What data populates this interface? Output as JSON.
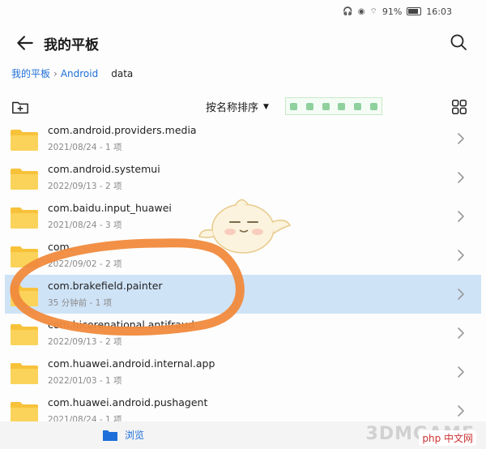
{
  "status_bar": {
    "battery": "91%",
    "time": "16:03"
  },
  "header": {
    "title": "我的平板"
  },
  "breadcrumb": {
    "items": [
      "我的平板",
      "Android"
    ],
    "current": "data"
  },
  "toolbar": {
    "sort_label": "按名称排序"
  },
  "files": [
    {
      "name": "com.android.providers.media",
      "meta": "2021/08/24 - 1 项"
    },
    {
      "name": "com.android.systemui",
      "meta": "2022/09/13 - 2 项"
    },
    {
      "name": "com.baidu.input_huawei",
      "meta": "2021/08/24 - 3 项"
    },
    {
      "name": "com.",
      "meta": "2022/09/02 - 2 项"
    },
    {
      "name": "com.brakefield.painter",
      "meta": "35 分钟前 - 1 项",
      "selected": true
    },
    {
      "name": "com.hicorenational.antifraud",
      "meta": "2022/09/13 - 2 项"
    },
    {
      "name": "com.huawei.android.internal.app",
      "meta": "2022/01/03 - 1 项"
    },
    {
      "name": "com.huawei.android.pushagent",
      "meta": "2021/08/24 - 1 项"
    }
  ],
  "bottom_bar": {
    "browse_label": "浏览"
  },
  "watermarks": {
    "site": "3DMGAME",
    "site2": "php 中文网"
  },
  "colors": {
    "accent": "#1e6fd9",
    "folder": "#f7c23a",
    "selected_row": "#cfe3f7",
    "annotation": "#f08a3c"
  }
}
